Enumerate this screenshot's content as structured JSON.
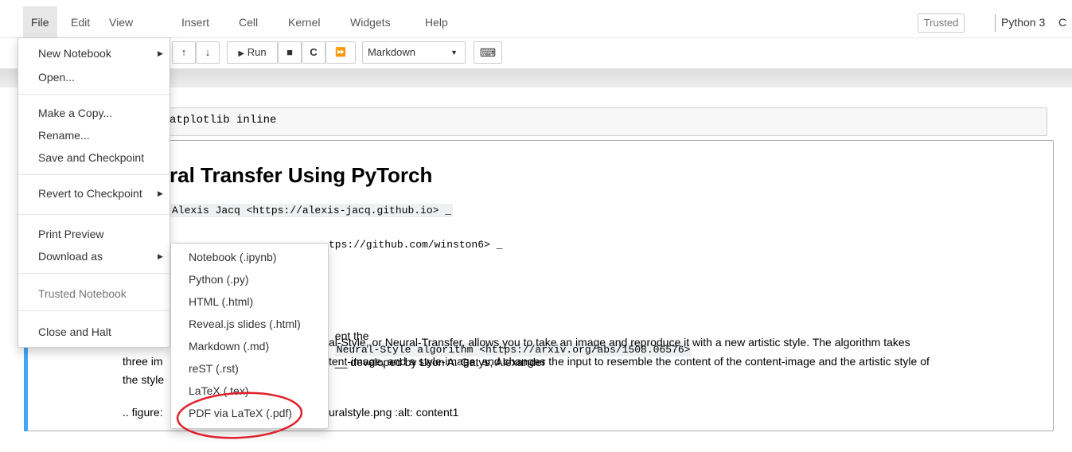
{
  "menubar": {
    "items": [
      "File",
      "Edit",
      "View",
      "Insert",
      "Cell",
      "Kernel",
      "Widgets",
      "Help"
    ],
    "trusted": "Trusted",
    "kernel_name": "Python 3",
    "kernel_indicator": "C"
  },
  "toolbar": {
    "up_icon": "↑",
    "down_icon": "↓",
    "run_label": "Run",
    "run_icon": "▶",
    "stop_icon": "■",
    "restart_icon": "C",
    "fast_forward_icon": "⏩",
    "cell_type": "Markdown",
    "keyboard_icon": "⌨"
  },
  "notebook": {
    "code_cell_text": "atplotlib inline",
    "heading": "ral Transfer Using PyTorch",
    "author_line": "Alexis Jacq <https://alexis-jacq.github.io> _",
    "editor_line": "tps://github.com/winston6> _",
    "para1_prefix": "ent the",
    "para1_code": "Neural-Style algorithm <https://arxiv.org/abs/1508.06576>",
    "para1_suffix": "__ developed by Leon A. Gatys, Alexander",
    "para2": "al-Style, or Neural-Transfer, allows you to take an image and reproduce it with a new artistic style. The algorithm takes",
    "para3_prefix": "three im",
    "para3": "tent-image, and a style-image, and changes the input to resemble the content of the content-image and the artistic style of",
    "para4": "the style",
    "figure_prefix": ".. figure:",
    "figure_suffix": "uralstyle.png :alt: content1"
  },
  "file_menu": {
    "new_notebook": "New Notebook",
    "open": "Open...",
    "make_copy": "Make a Copy...",
    "rename": "Rename...",
    "save_checkpoint": "Save and Checkpoint",
    "revert_checkpoint": "Revert to Checkpoint",
    "print_preview": "Print Preview",
    "download_as": "Download as",
    "trusted_notebook": "Trusted Notebook",
    "close_halt": "Close and Halt"
  },
  "download_menu": {
    "items": [
      "Notebook (.ipynb)",
      "Python (.py)",
      "HTML (.html)",
      "Reveal.js slides (.html)",
      "Markdown (.md)",
      "reST (.rst)",
      "LaTeX (.tex)",
      "PDF via LaTeX (.pdf)"
    ]
  },
  "colors": {
    "cell_selected_bar": "#42a5f5",
    "annotation": "#e0202a"
  }
}
